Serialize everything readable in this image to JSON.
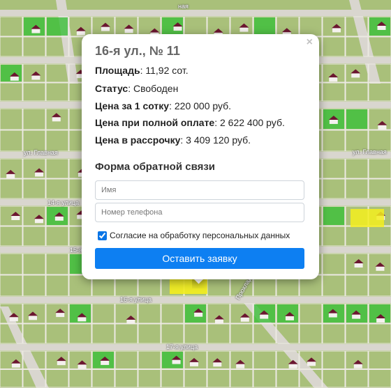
{
  "map": {
    "street_labels": [
      "ул. Главная",
      "ул. Главная",
      "14-я улица",
      "15-я",
      "16-я улица",
      "17-я улица",
      "Прохладная",
      "ная"
    ],
    "colors": {
      "grass": "#a9c07a",
      "road": "#d9d6cf",
      "plot_line": "#ece9e2",
      "free_plot": "#3bbf3a",
      "selected_plot": "#f4ee1e",
      "house_roof": "#6b1730"
    }
  },
  "popup": {
    "title": "16-я ул., № 11",
    "close_symbol": "×",
    "rows": [
      {
        "label": "Площадь",
        "value": ": 11,92 сот."
      },
      {
        "label": "Статус",
        "value": ": Свободен"
      },
      {
        "label": "Цена за 1 сотку",
        "value": ": 220 000 руб."
      },
      {
        "label": "Цена при полной оплате",
        "value": ": 2 622 400 руб."
      },
      {
        "label": "Цена в рассрочку",
        "value": ": 3 409 120 руб."
      }
    ],
    "form": {
      "title": "Форма обратной связи",
      "name_placeholder": "Имя",
      "phone_placeholder": "Номер телефона",
      "consent_label": "Согласие на обработку персональных данных",
      "consent_checked": true,
      "submit_label": "Оставить заявку"
    }
  }
}
